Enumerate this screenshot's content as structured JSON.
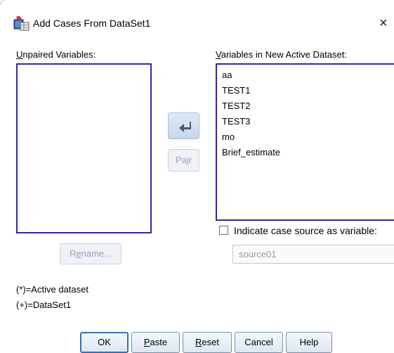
{
  "window": {
    "title": "Add Cases From DataSet1",
    "close_glyph": "×"
  },
  "unpaired": {
    "label_mnemonic": "U",
    "label_rest": "npaired Variables:",
    "items": []
  },
  "new_dataset": {
    "label_mnemonic": "V",
    "label_rest": "ariables in New Active Dataset:",
    "items": [
      "aa",
      "TEST1",
      "TEST2",
      "TEST3",
      "mo",
      "Brief_estimate"
    ]
  },
  "buttons": {
    "move_icon": "arrow-left-icon",
    "pair_pre": "Pa",
    "pair_mnemonic": "i",
    "pair_post": "r",
    "rename_pre": "R",
    "rename_mnemonic": "e",
    "rename_post": "name...",
    "ok": "OK",
    "paste_mnemonic": "P",
    "paste_rest": "aste",
    "reset_mnemonic": "R",
    "reset_rest": "eset",
    "cancel": "Cancel",
    "help": "Help"
  },
  "indicate": {
    "checked": false,
    "label": "Indicate case source as variable:",
    "source_value": "source01"
  },
  "legend": {
    "active": "(*)=Active dataset",
    "dataset1": "(+)=DataSet1"
  },
  "colors": {
    "listbox_border": "#2c2ca0",
    "default_button_border": "#3a6fb0",
    "disabled_text": "#9aa4ad"
  }
}
